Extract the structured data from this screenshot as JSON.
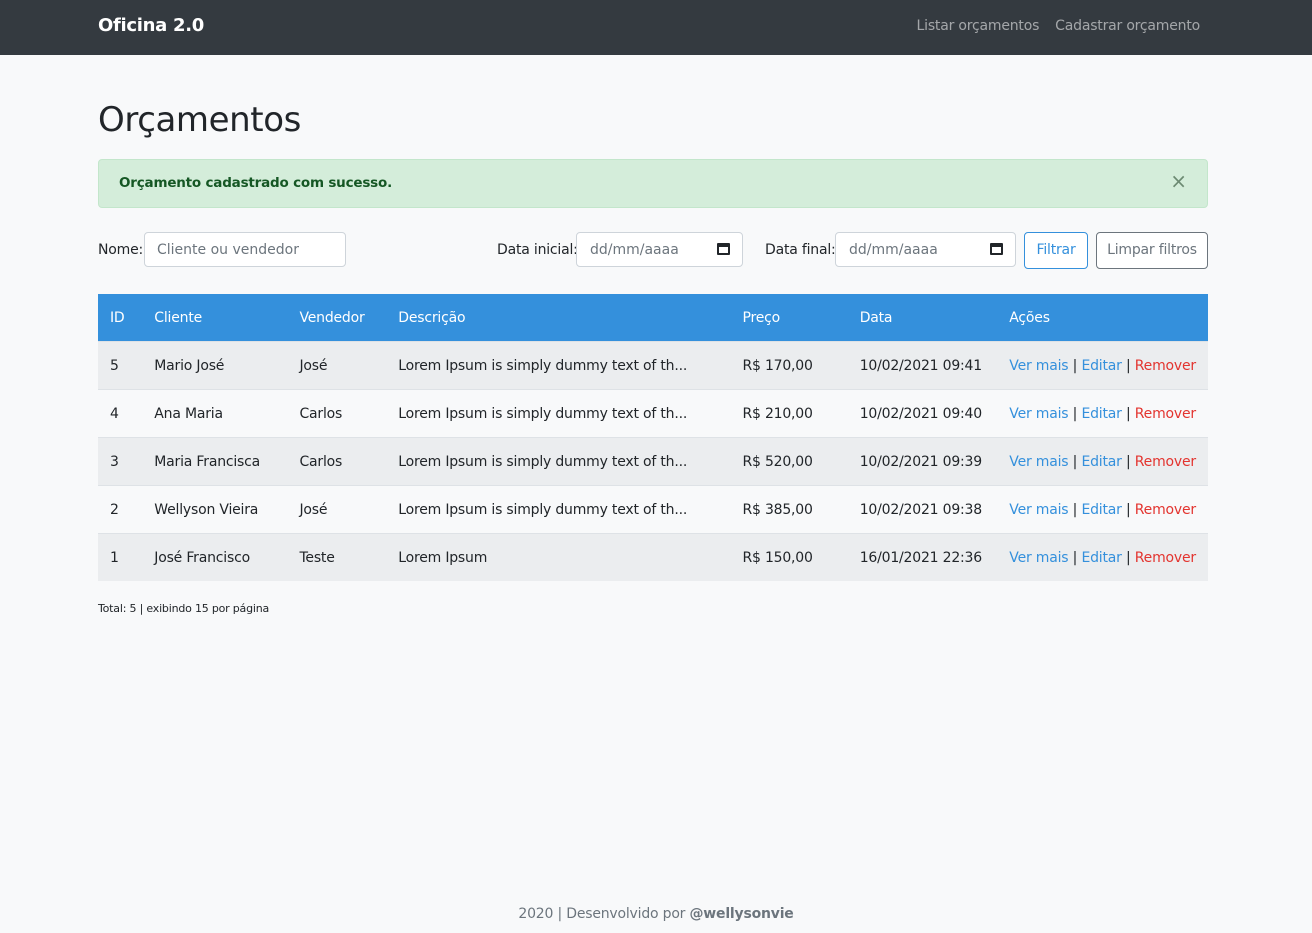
{
  "navbar": {
    "brand": "Oficina 2.0",
    "links": [
      "Listar orçamentos",
      "Cadastrar orçamento"
    ]
  },
  "page": {
    "title": "Orçamentos"
  },
  "alert": {
    "message": "Orçamento cadastrado com sucesso.",
    "close_icon": "×"
  },
  "filters": {
    "name_label": "Nome:",
    "name_placeholder": "Cliente ou vendedor",
    "start_label": "Data inicial:",
    "start_placeholder": "dd/mm/aaaa",
    "end_label": "Data final:",
    "end_placeholder": "dd/mm/aaaa",
    "filter_button": "Filtrar",
    "clear_button": "Limpar filtros"
  },
  "table": {
    "headers": [
      "ID",
      "Cliente",
      "Vendedor",
      "Descrição",
      "Preço",
      "Data",
      "Ações"
    ],
    "rows": [
      {
        "id": "5",
        "cliente": "Mario José",
        "vendedor": "José",
        "descricao": "Lorem Ipsum is simply dummy text of th...",
        "preco": "R$ 170,00",
        "data": "10/02/2021 09:41"
      },
      {
        "id": "4",
        "cliente": "Ana Maria",
        "vendedor": "Carlos",
        "descricao": "Lorem Ipsum is simply dummy text of th...",
        "preco": "R$ 210,00",
        "data": "10/02/2021 09:40"
      },
      {
        "id": "3",
        "cliente": "Maria Francisca",
        "vendedor": "Carlos",
        "descricao": "Lorem Ipsum is simply dummy text of th...",
        "preco": "R$ 520,00",
        "data": "10/02/2021 09:39"
      },
      {
        "id": "2",
        "cliente": "Wellyson Vieira",
        "vendedor": "José",
        "descricao": "Lorem Ipsum is simply dummy text of th...",
        "preco": "R$ 385,00",
        "data": "10/02/2021 09:38"
      },
      {
        "id": "1",
        "cliente": "José Francisco",
        "vendedor": "Teste",
        "descricao": "Lorem Ipsum",
        "preco": "R$ 150,00",
        "data": "16/01/2021 22:36"
      }
    ],
    "actions": {
      "view": "Ver mais",
      "edit": "Editar",
      "remove": "Remover",
      "separator": "|"
    }
  },
  "pagination": {
    "total_text": "Total: 5 | exibindo 15 por página"
  },
  "footer": {
    "text": "2020 | Desenvolvido por ",
    "author": "@wellysonvie"
  },
  "colors": {
    "navbar": "#343a40",
    "primary": "#3490dc",
    "danger": "#e3342f",
    "success_bg": "#d4edda",
    "success_text": "#155724"
  }
}
